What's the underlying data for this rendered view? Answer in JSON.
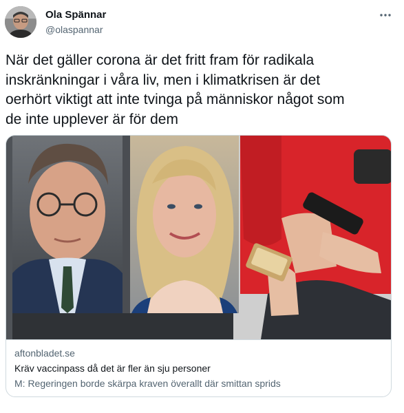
{
  "author": {
    "name": "Ola Spännar",
    "handle": "@olaspannar"
  },
  "tweet": {
    "text": "När det gäller corona är det fritt fram för radikala\ninskränkningar i våra liv, men i klimatkrisen är det\noerhört viktigt att inte tvinga på människor något som\nde inte upplever är för dem"
  },
  "link_card": {
    "domain": "aftonbladet.se",
    "title": "Kräv vaccinpass då det är fler än sju personer",
    "description": "M: Regeringen borde skärpa kraven överallt där smittan sprids"
  },
  "icons": {
    "more": "more-horizontal-icon",
    "avatar": "profile-photo"
  },
  "colors": {
    "text_primary": "#0f1419",
    "text_secondary": "#536471",
    "border": "#cfd9de",
    "shirt_red": "#d8242a"
  }
}
